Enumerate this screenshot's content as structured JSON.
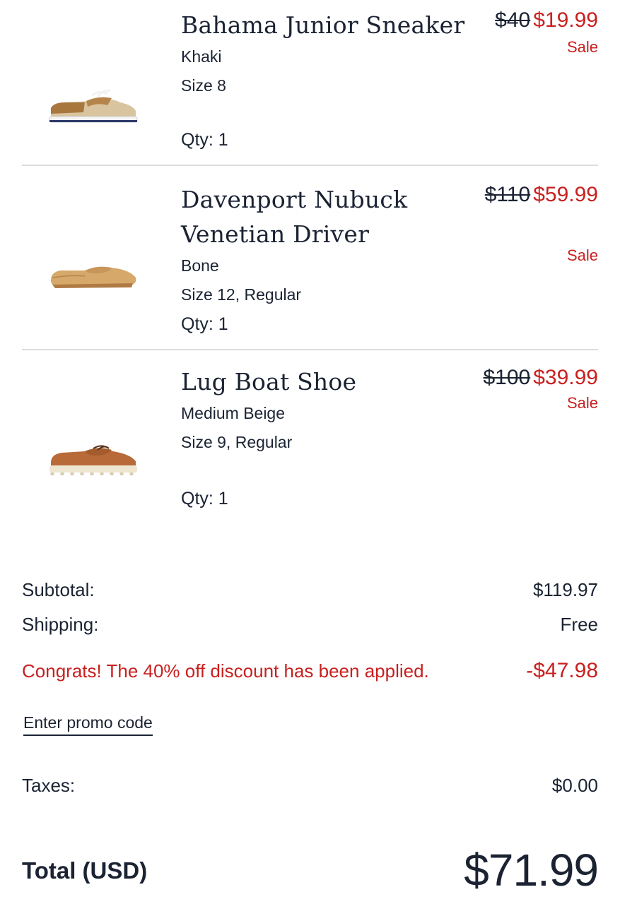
{
  "cart": {
    "items": [
      {
        "name": "Bahama Junior Sneaker",
        "color": "Khaki",
        "size": "Size 8",
        "qty": "Qty: 1",
        "original_price": "$40",
        "sale_price": "$19.99",
        "sale_tag": "Sale",
        "image_icon": "boat-sneaker-shoe-icon"
      },
      {
        "name_line1": "Davenport Nubuck",
        "name_line2": "Venetian Driver",
        "color": "Bone",
        "size": "Size 12, Regular",
        "qty": "Qty: 1",
        "original_price": "$110",
        "sale_price": "$59.99",
        "sale_tag": "Sale",
        "image_icon": "loafer-driver-shoe-icon"
      },
      {
        "name": "Lug Boat Shoe",
        "color": "Medium Beige",
        "size": "Size 9, Regular",
        "qty": "Qty: 1",
        "original_price": "$100",
        "sale_price": "$39.99",
        "sale_tag": "Sale",
        "image_icon": "lug-boat-shoe-icon"
      }
    ]
  },
  "summary": {
    "subtotal_label": "Subtotal:",
    "subtotal_value": "$119.97",
    "shipping_label": "Shipping:",
    "shipping_value": "Free",
    "discount_message": "Congrats! The 40% off discount has been applied.",
    "discount_value": "-$47.98",
    "promo_link": "Enter promo code",
    "taxes_label": "Taxes:",
    "taxes_value": "$0.00",
    "total_label": "Total (USD)",
    "total_value": "$71.99"
  },
  "colors": {
    "text": "#1b2333",
    "sale_red": "#c8201f",
    "divider": "#dcdcdc"
  }
}
